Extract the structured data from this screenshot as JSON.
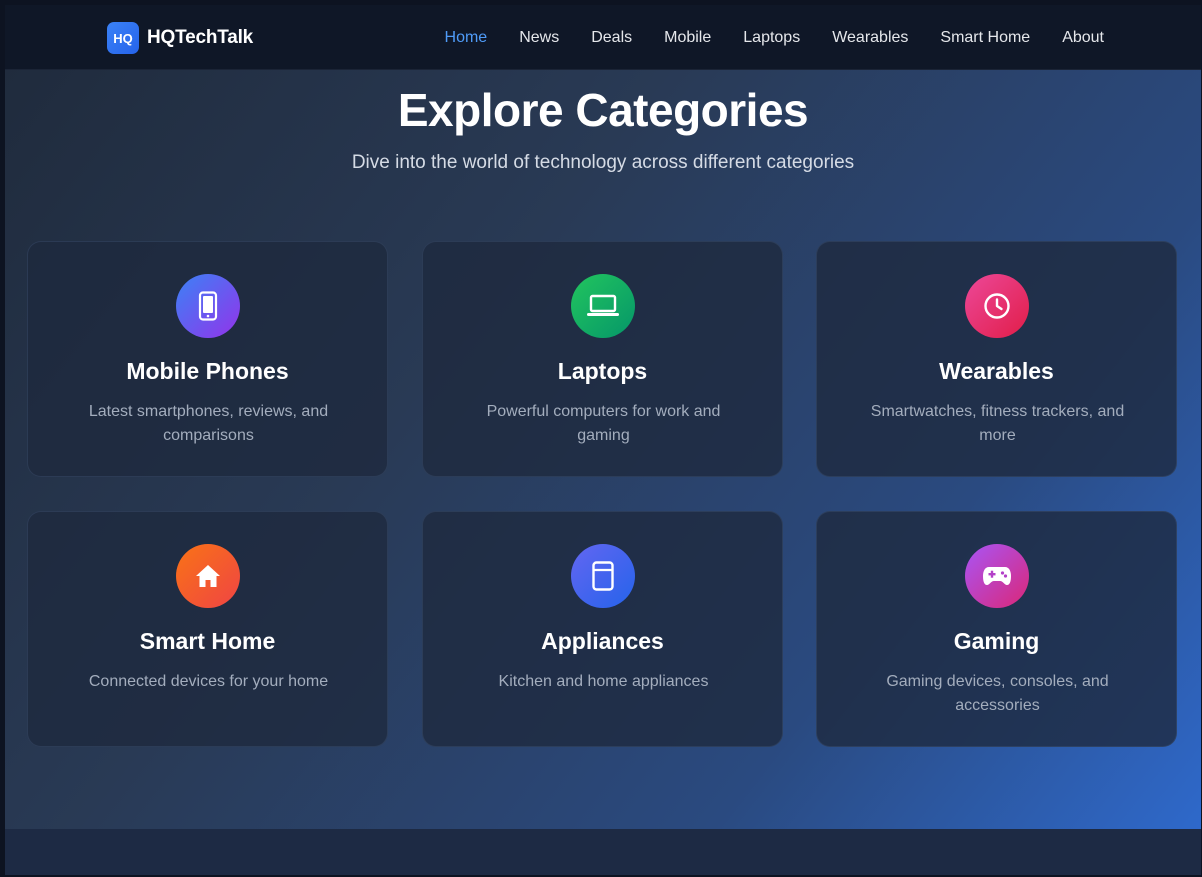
{
  "brand": {
    "logo_text": "HQ",
    "name": "HQTechTalk"
  },
  "nav": {
    "items": [
      {
        "label": "Home",
        "active": true
      },
      {
        "label": "News"
      },
      {
        "label": "Deals"
      },
      {
        "label": "Mobile"
      },
      {
        "label": "Laptops"
      },
      {
        "label": "Wearables"
      },
      {
        "label": "Smart Home"
      },
      {
        "label": "About"
      }
    ],
    "active_color": "#4f9bf7"
  },
  "hero": {
    "title": "Explore Categories",
    "subtitle": "Dive into the world of technology across different categories"
  },
  "categories": [
    {
      "title": "Mobile Phones",
      "description": "Latest smartphones, reviews, and comparisons",
      "icon": "smartphone-icon",
      "gradient": [
        "#3b82f6",
        "#9333ea"
      ]
    },
    {
      "title": "Laptops",
      "description": "Powerful computers for work and gaming",
      "icon": "laptop-icon",
      "gradient": [
        "#22c55e",
        "#059669"
      ]
    },
    {
      "title": "Wearables",
      "description": "Smartwatches, fitness trackers, and more",
      "icon": "clock-icon",
      "gradient": [
        "#ec4899",
        "#e11d48"
      ]
    },
    {
      "title": "Smart Home",
      "description": "Connected devices for your home",
      "icon": "home-icon",
      "gradient": [
        "#f97316",
        "#ef4444"
      ]
    },
    {
      "title": "Appliances",
      "description": "Kitchen and home appliances",
      "icon": "appliance-icon",
      "gradient": [
        "#6366f1",
        "#2563eb"
      ]
    },
    {
      "title": "Gaming",
      "description": "Gaming devices, consoles, and accessories",
      "icon": "gamepad-icon",
      "gradient": [
        "#a855f7",
        "#db2777"
      ]
    }
  ]
}
